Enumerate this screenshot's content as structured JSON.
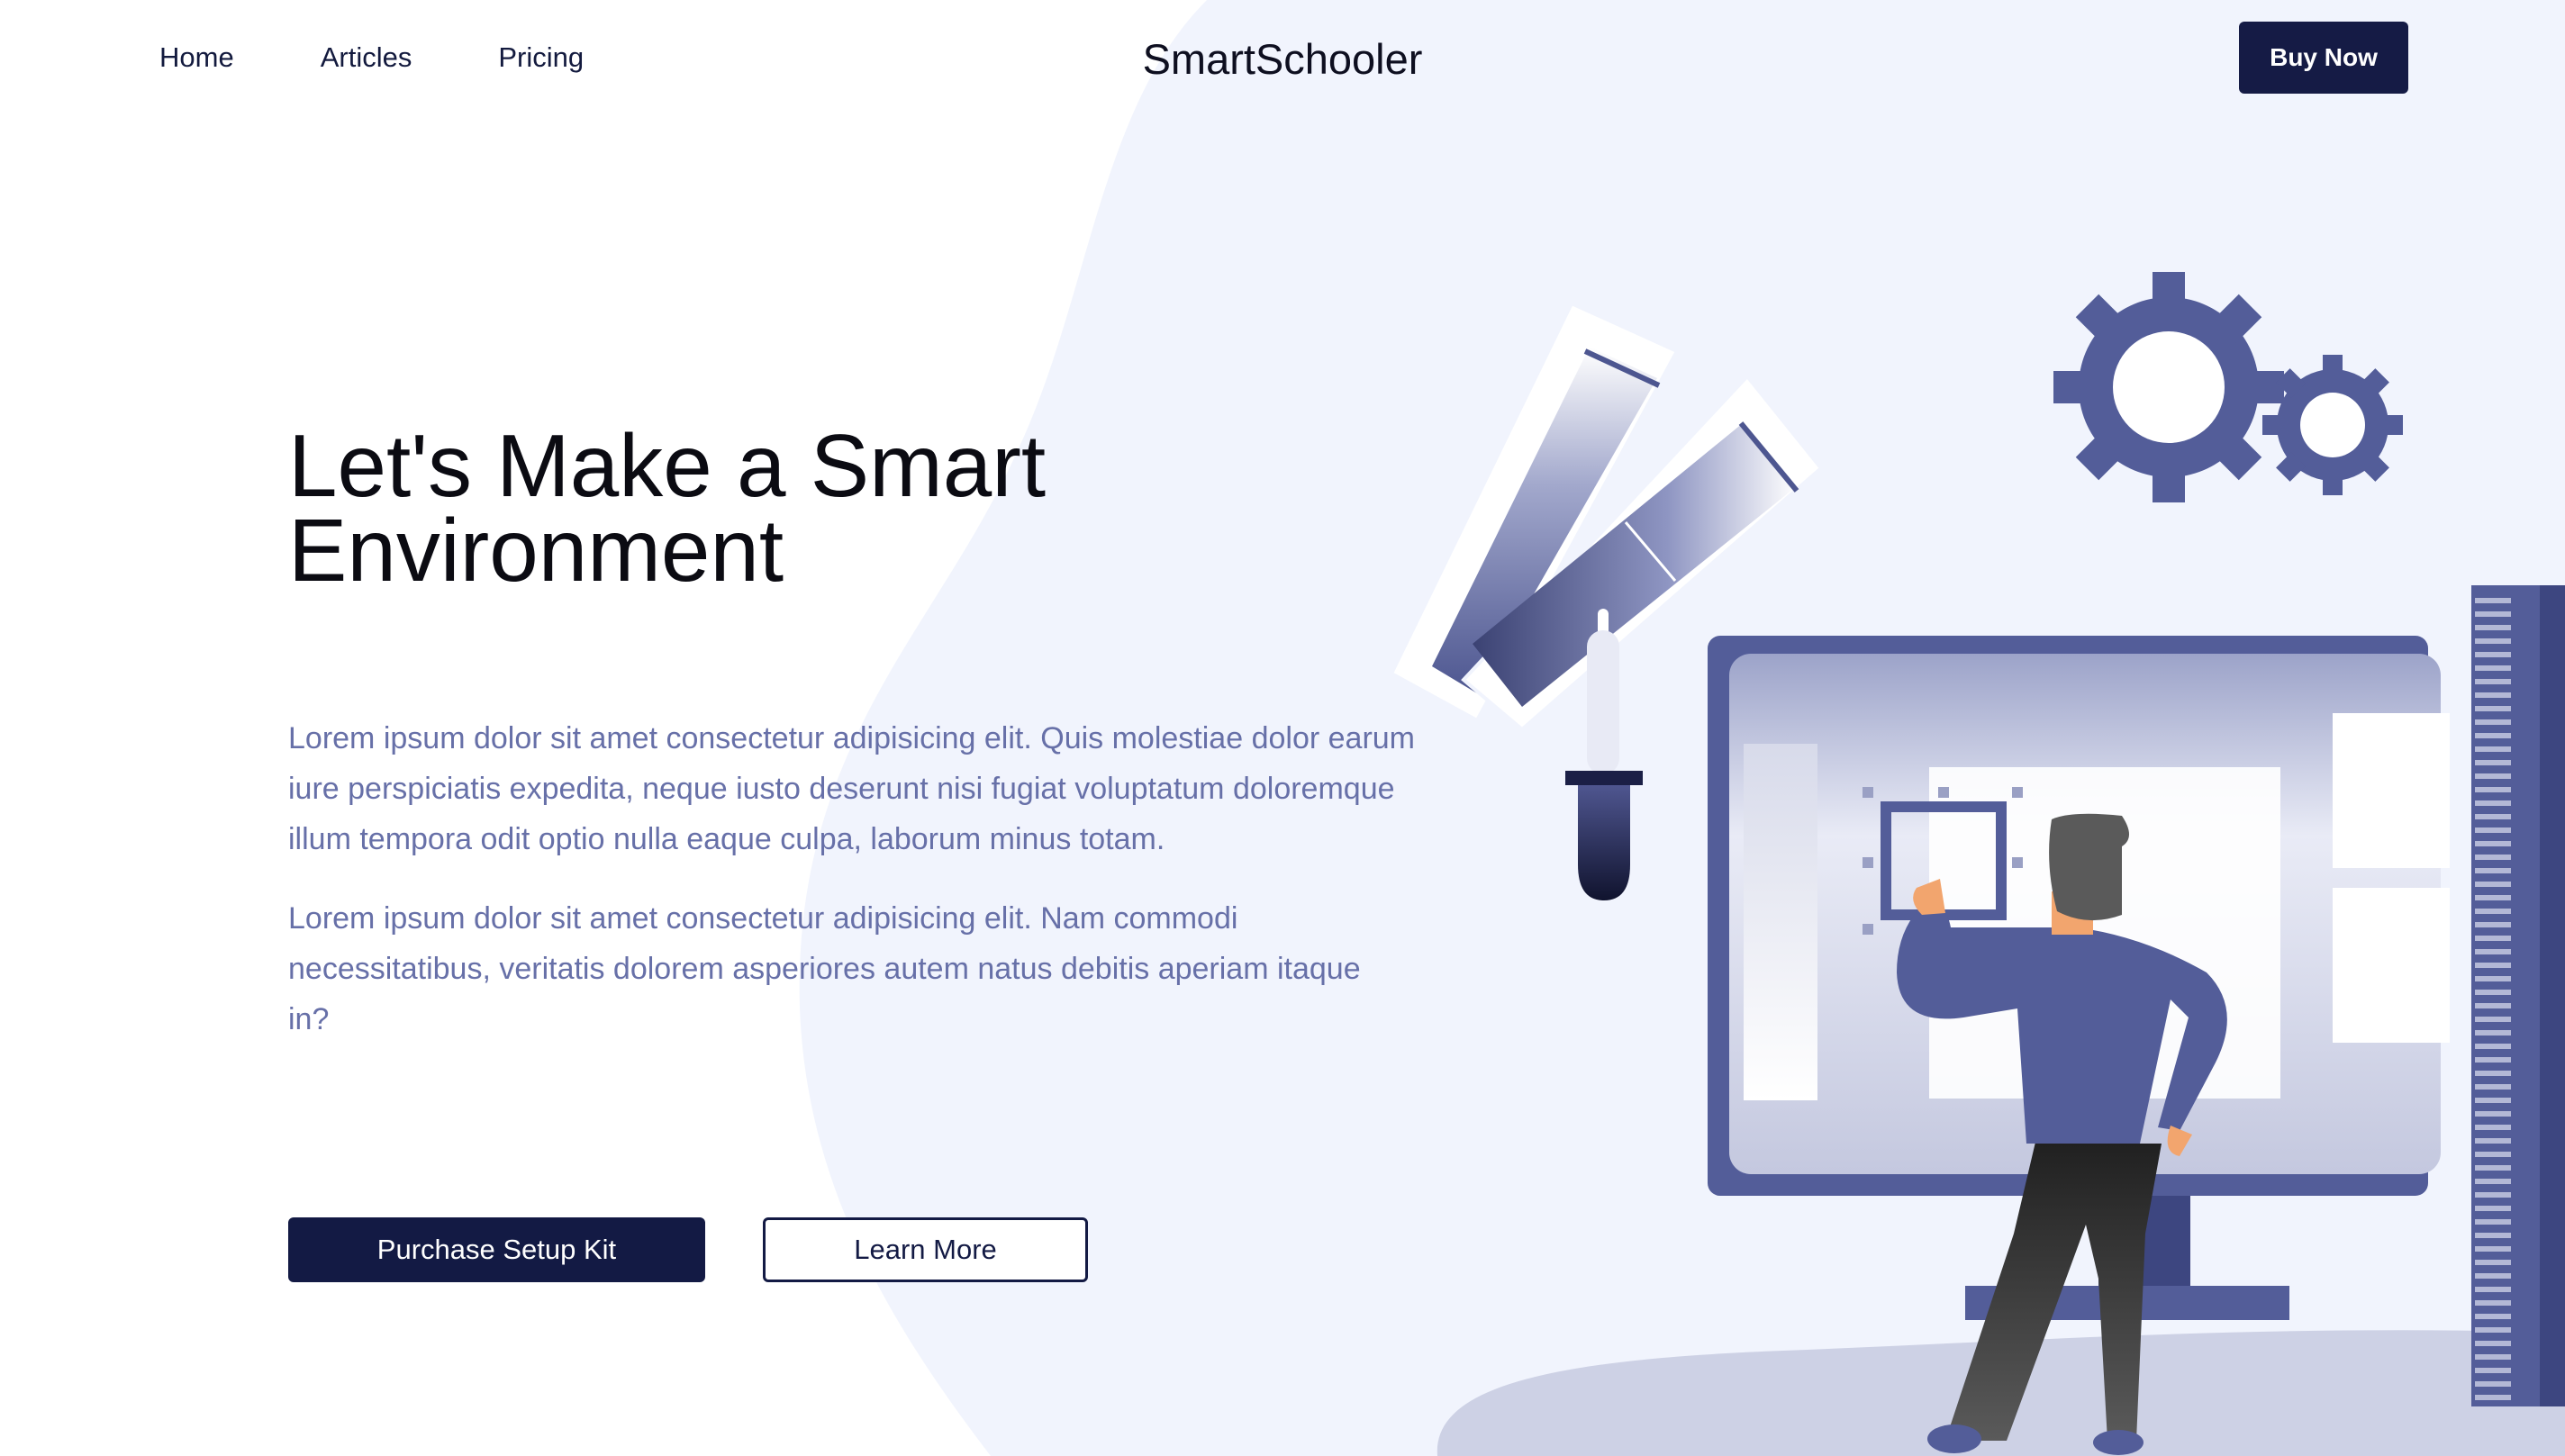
{
  "nav": {
    "links": [
      {
        "label": "Home"
      },
      {
        "label": "Articles"
      },
      {
        "label": "Pricing"
      }
    ],
    "brand": "SmartSchooler",
    "cta_label": "Buy Now"
  },
  "hero": {
    "title": "Let's Make a Smart Environment",
    "paragraphs": [
      "Lorem ipsum dolor sit amet consectetur adipisicing elit. Quis molestiae dolor earum iure perspiciatis expedita, neque iusto deserunt nisi fugiat voluptatum doloremque illum tempora odit optio nulla eaque culpa, laborum minus totam.",
      "Lorem ipsum dolor sit amet consectetur adipisicing elit. Nam commodi necessitatibus, veritatis dolorem asperiores autem natus debitis aperiam itaque in?"
    ],
    "primary_button": "Purchase Setup Kit",
    "secondary_button": "Learn More"
  },
  "colors": {
    "navy": "#131a44",
    "accent": "#535d99",
    "text_muted": "#6770a8",
    "bg_blob": "#f1f4fd"
  },
  "illustration": {
    "elements": [
      "color-swatch-icon",
      "eyedropper-icon",
      "gear-icon",
      "monitor",
      "person",
      "ruler"
    ]
  }
}
